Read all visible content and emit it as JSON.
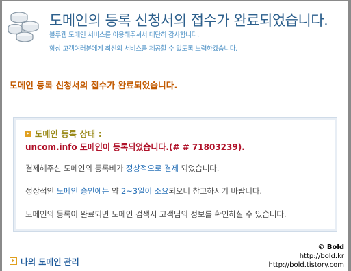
{
  "header": {
    "title": "도메인의 등록 신청서의 접수가 완료되었습니다.",
    "subtitle_1": "블루웹 도메인 서비스를 이용해주셔서 대단히 감사합니다.",
    "subtitle_2": "항상 고객여러분에게 최선의 서비스를 제공할 수 있도록 노력하겠습니다.",
    "icon": "coins-stack-icon"
  },
  "headline": "도메인 등록 신청서의 접수가 완료되었습니다.",
  "panel": {
    "status_label": "도메인 등록 상태 :",
    "status_value": "uncom.info 도메인이 등록되었습니다.(# # 71803239).",
    "payment": {
      "prefix": "결제해주신 도메인의 등록비가 ",
      "highlight": "정상적으로 결제",
      "suffix": " 되었습니다."
    },
    "approval": {
      "prefix": "정상적인 ",
      "highlight_1": "도메인 승인에는",
      "middle": " 약 ",
      "highlight_2": "2~3일이 소요",
      "suffix": "되오니 참고하시기 바랍니다."
    },
    "search_note": "도메인의 등록이 완료되면 도메인 검색시 고객님의 정보를 확인하실 수 있습니다."
  },
  "bottom": {
    "my_domain_link": "나의 도메인 관리"
  },
  "watermark": {
    "line_1": "© Bold",
    "line_2": "http://bold.kr",
    "line_3": "http://bold.tistory.com"
  },
  "colors": {
    "title": "#2c5f8c",
    "subtitle": "#4a8fc4",
    "headline": "#c25a00",
    "status_label": "#9a8a1a",
    "status_value": "#b0122a",
    "highlight": "#2a72b8",
    "link": "#1e5a9a"
  }
}
